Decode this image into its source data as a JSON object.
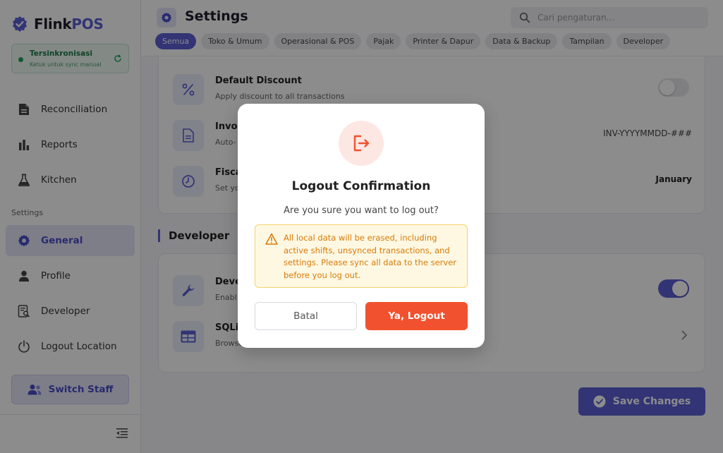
{
  "app": {
    "logo_part1": "Flink",
    "logo_part2": "POS",
    "sync": {
      "title": "Tersinkronisasi",
      "subtitle": "Ketuk untuk sync manual"
    }
  },
  "sidebar": {
    "items": [
      {
        "label": "Reconciliation",
        "icon": "document-icon"
      },
      {
        "label": "Reports",
        "icon": "bar-chart-icon"
      },
      {
        "label": "Kitchen",
        "icon": "flask-icon"
      }
    ],
    "section_label": "Settings",
    "settings_items": [
      {
        "label": "General",
        "icon": "gear-icon",
        "active": true
      },
      {
        "label": "Profile",
        "icon": "person-icon"
      },
      {
        "label": "Developer",
        "icon": "document-search-icon"
      },
      {
        "label": "Logout Location",
        "icon": "power-icon"
      }
    ],
    "switch_staff": "Switch Staff"
  },
  "header": {
    "title": "Settings",
    "search_placeholder": "Cari pengaturan...",
    "tabs": [
      "Semua",
      "Toko & Umum",
      "Operasional & POS",
      "Pajak",
      "Printer & Dapur",
      "Data & Backup",
      "Tampilan",
      "Developer"
    ],
    "active_tab": 0
  },
  "settings": {
    "default_discount": {
      "title": "Default Discount",
      "subtitle": "Apply discount to all transactions",
      "enabled": false
    },
    "invoice": {
      "title": "Invoic",
      "subtitle": "Auto-",
      "value": "INV-YYYYMMDD-###"
    },
    "fiscal": {
      "title": "Fisca",
      "subtitle": "Set yo",
      "value": "January"
    },
    "developer_section": "Developer",
    "developer_mode": {
      "title": "Deve",
      "subtitle": "Enabl",
      "enabled": true
    },
    "sqlite": {
      "title": "SQLit",
      "subtitle": "Browse"
    },
    "save_label": "Save Changes"
  },
  "modal": {
    "title": "Logout Confirmation",
    "subtitle": "Are you sure you want to log out?",
    "warning": "All local data will be erased, including active shifts, unsynced transactions, and settings. Please sync all data to the server before you log out.",
    "cancel_label": "Batal",
    "confirm_label": "Ya, Logout"
  },
  "colors": {
    "accent": "#5b5fd6",
    "danger": "#f2512f",
    "warning": "#d97a06",
    "success": "#1fa35b"
  }
}
